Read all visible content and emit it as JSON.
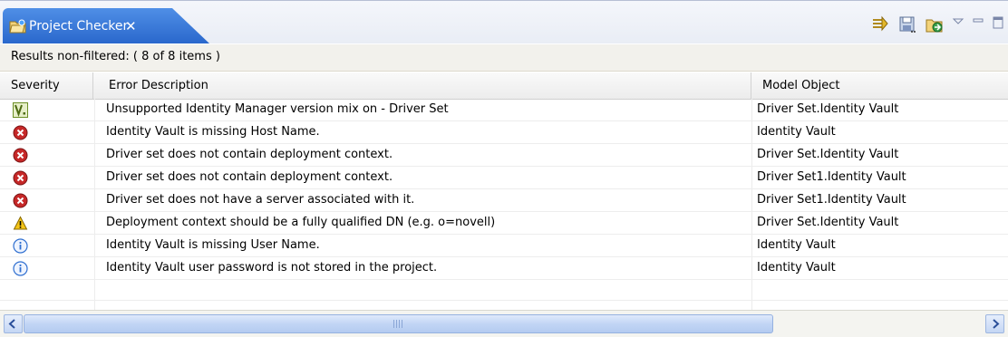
{
  "view": {
    "tab_title": "Project Checker",
    "tab_close": "✕",
    "toolbar": {
      "icons": [
        "go-to-problem-icon",
        "save-report-icon",
        "export-icon",
        "view-menu-icon",
        "minimize-icon",
        "maximize-icon"
      ]
    }
  },
  "status": {
    "text": "Results non-filtered: ( 8 of 8 items )"
  },
  "table": {
    "columns": [
      "Severity",
      "Error Description",
      "Model Object"
    ],
    "rows": [
      {
        "severity": "version-mismatch",
        "description": "Unsupported Identity Manager version mix on - Driver Set",
        "model": "Driver Set.Identity Vault"
      },
      {
        "severity": "error",
        "description": "Identity Vault is missing Host Name.",
        "model": "Identity Vault"
      },
      {
        "severity": "error",
        "description": "Driver set does not contain deployment context.",
        "model": "Driver Set.Identity Vault"
      },
      {
        "severity": "error",
        "description": "Driver set does not contain deployment context.",
        "model": "Driver Set1.Identity Vault"
      },
      {
        "severity": "error",
        "description": "Driver set does not have a server associated with it.",
        "model": "Driver Set1.Identity Vault"
      },
      {
        "severity": "warning",
        "description": "Deployment context should be a fully qualified DN (e.g. o=novell)",
        "model": "Driver Set.Identity Vault"
      },
      {
        "severity": "info",
        "description": "Identity Vault is missing User Name.",
        "model": "Identity Vault"
      },
      {
        "severity": "info",
        "description": "Identity Vault user password is not stored in the project.",
        "model": "Identity Vault"
      }
    ]
  },
  "colors": {
    "tab_blue": "#2a68cc",
    "error_red": "#c62828",
    "warning_yellow": "#f5c518",
    "info_blue": "#2f6fd0",
    "version_green": "#6b8e23"
  }
}
